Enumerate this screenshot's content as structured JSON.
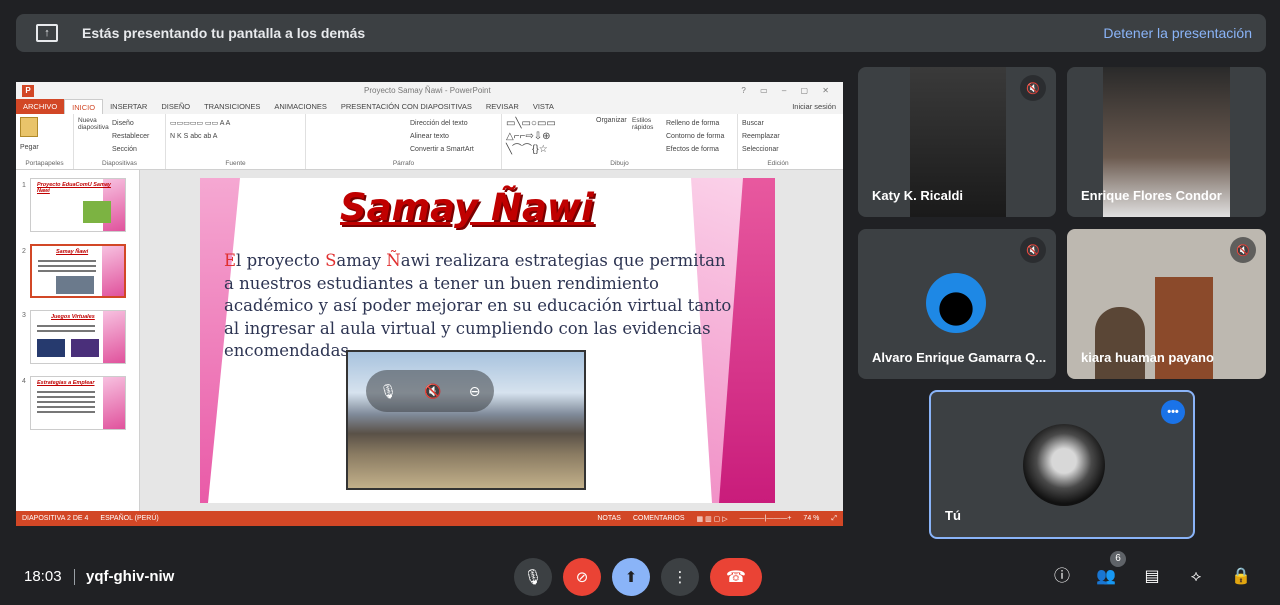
{
  "banner": {
    "icon": "present-screen-icon",
    "text": "Estás presentando tu pantalla a los demás",
    "stop_label": "Detener la presentación"
  },
  "powerpoint": {
    "window_title": "Proyecto Samay Ñawi - PowerPoint",
    "login": "Iniciar sesión",
    "tabs": [
      "ARCHIVO",
      "INICIO",
      "INSERTAR",
      "DISEÑO",
      "TRANSICIONES",
      "ANIMACIONES",
      "PRESENTACIÓN CON DIAPOSITIVAS",
      "REVISAR",
      "VISTA"
    ],
    "ribbon": {
      "paste": "Pegar",
      "clipboard_group": "Portapapeles",
      "new_slide": "Nueva diapositiva",
      "layout": "Diseño",
      "reset": "Restablecer",
      "section": "Sección",
      "slides_group": "Diapositivas",
      "font_group": "Fuente",
      "text_direction": "Dirección del texto",
      "align_text": "Alinear texto",
      "smartart": "Convertir a SmartArt",
      "paragraph_group": "Párrafo",
      "arrange": "Organizar",
      "quick_styles": "Estilos rápidos",
      "shape_fill": "Relleno de forma",
      "shape_outline": "Contorno de forma",
      "shape_effects": "Efectos de forma",
      "drawing_group": "Dibujo",
      "find": "Buscar",
      "replace": "Reemplazar",
      "select": "Seleccionar",
      "editing_group": "Edición"
    },
    "thumbnails": [
      {
        "num": "1",
        "title": "Proyecto EduaComU Samay Ñawi"
      },
      {
        "num": "2",
        "title": "Samay Ñawi"
      },
      {
        "num": "3",
        "title": "Juegos Virtuales"
      },
      {
        "num": "4",
        "title": "Estrategias a Emplear"
      }
    ],
    "slide": {
      "title": "Samay Ñawi",
      "body_first_1": "E",
      "body_1": "l proyecto ",
      "body_first_2": "S",
      "body_2": "amay ",
      "body_first_3": "Ñ",
      "body_3": "awi realizara estrategias que permitan a nuestros estudiantes a tener un buen rendimiento académico y así poder mejorar en su educación virtual tanto al ingresar al aula virtual y cumpliendo con las evidencias encomendadas."
    },
    "status": {
      "slide_num": "DIAPOSITIVA 2 DE 4",
      "language": "ESPAÑOL (PERÚ)",
      "notes": "NOTAS",
      "comments": "COMENTARIOS",
      "zoom": "74 %"
    }
  },
  "participants": [
    {
      "name": "Katy K. Ricaldi",
      "muted": true
    },
    {
      "name": "Enrique Flores Condor",
      "muted": false
    },
    {
      "name": "Alvaro Enrique Gamarra Q...",
      "muted": true
    },
    {
      "name": "kiara huaman payano",
      "muted": true
    },
    {
      "name": "Tú",
      "muted": false
    }
  ],
  "bottom": {
    "time": "18:03",
    "meeting_code": "yqf-ghiv-niw",
    "people_count": "6"
  },
  "colors": {
    "background": "#202124",
    "tile": "#3c4043",
    "accent": "#8ab4f8",
    "danger": "#ea4335",
    "ppt_orange": "#d24726"
  }
}
